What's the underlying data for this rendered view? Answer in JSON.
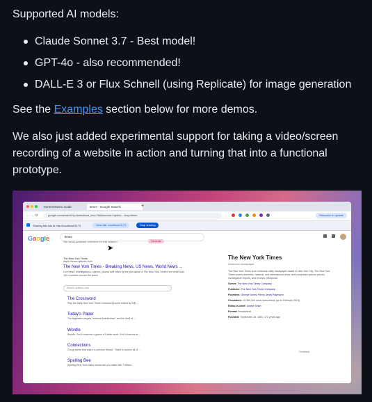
{
  "intro": "Supported AI models:",
  "models": [
    "Claude Sonnet 3.7 - Best model!",
    "GPT-4o - also recommended!",
    "DALL-E 3 or Flux Schnell (using Replicate) for image generation"
  ],
  "examples_prefix": "See the ",
  "examples_link": "Examples",
  "examples_suffix": " section below for more demos.",
  "video_text": "We also just added experimental support for taking a video/screen recording of a website in action and turning that into a functional prototype.",
  "screenshot": {
    "tabs": [
      "Screenshot to Code",
      "times - Google Search"
    ],
    "url": "google.com/search?q=times&sca_esv=7d6&source=hp&ei=...&oq=times",
    "relaunch": "Relaunch to update",
    "share_text": "Sharing this tab to http://localhost:5173",
    "share_view": "View tab: localhost:5173",
    "share_stop": "Stop sharing",
    "google_logo": "Google",
    "query": "times",
    "ai_prompt": "Get an AI-powered overview for this search?",
    "ai_button": "Generate",
    "result_site": "The New York Times",
    "result_url": "https://www.nytimes.com",
    "result_title": "The New York Times - Breaking News, US News, World News ...",
    "result_desc": "Live news, investigations, opinion, photos and video by the journalists of The New York Times from more than 150 countries around the world.",
    "site_search": "Search nytimes.com",
    "sublinks": [
      {
        "title": "The Crossword",
        "desc": "Play the Daily New York Times Crossword puzzle edited by Will ..."
      },
      {
        "title": "Today's Paper",
        "desc": "The legislation targets \"external interference\" and the theft of ..."
      },
      {
        "title": "Wordle",
        "desc": "Wordle. Get 6 chances to guess a 5-letter word. Get 6 chances to ..."
      },
      {
        "title": "Connections",
        "desc": "Group words that share a common thread. · Want to access all of ..."
      },
      {
        "title": "Spelling Bee",
        "desc": "Spelling Bee. How many words can you make with 7 letters ..."
      }
    ],
    "kp_title": "The New York Times",
    "kp_subtitle": "American newspaper",
    "kp_desc": "The New York Times is an American daily newspaper based in New York City. The New York Times covers domestic, national, and international news, and comprises opinion pieces, investigative reports, and reviews. Wikipedia",
    "kp_rows": [
      {
        "label": "Owner:",
        "value": "The New York Times Company"
      },
      {
        "label": "Publisher:",
        "value": "The New York Times Company"
      },
      {
        "label": "Founders:",
        "value": "George Jones, Henry Jarvis Raymond"
      },
      {
        "label": "Circulation:",
        "value": "10,360,000 news subscribers (as of February 2024)"
      },
      {
        "label": "Editor-in-chief:",
        "value": "Joseph Kahn"
      },
      {
        "label": "Format:",
        "value": "Broadsheet"
      },
      {
        "label": "Founded:",
        "value": "September 18, 1851; 172 years ago"
      }
    ],
    "feedback": "Feedback"
  }
}
